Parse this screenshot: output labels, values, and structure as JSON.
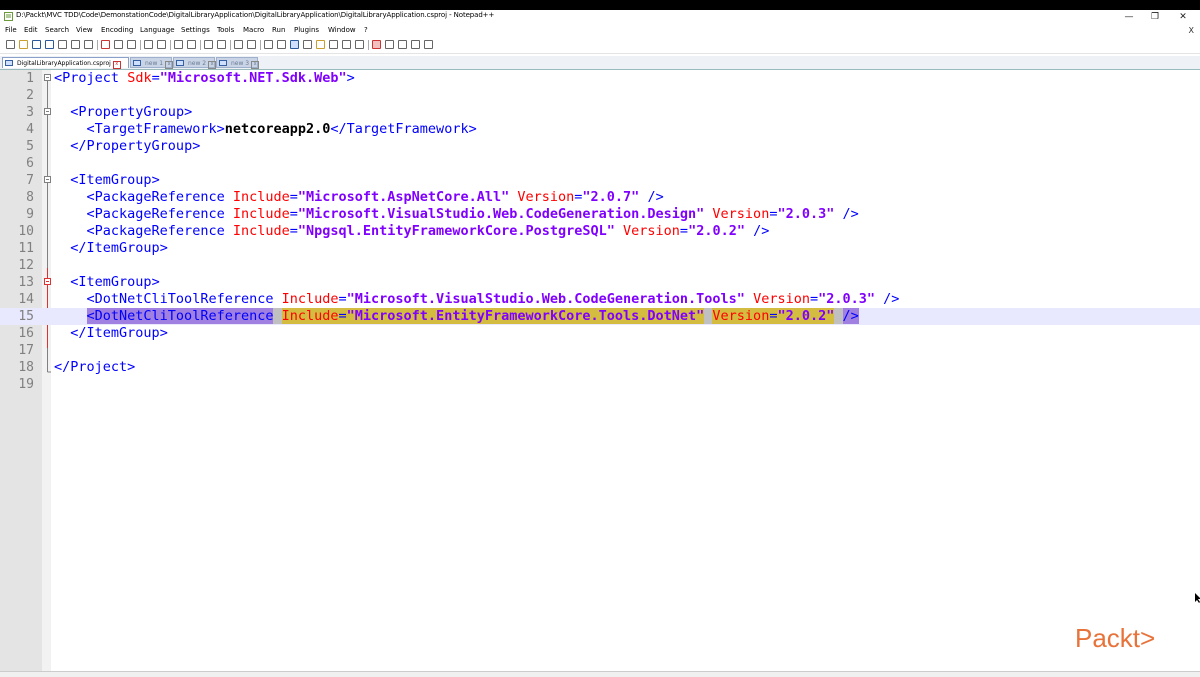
{
  "window": {
    "title": "D:\\Packt\\MVC TDD\\Code\\DemonstationCode\\DigitalLibraryApplication\\DigitalLibraryApplication\\DigitalLibraryApplication.csproj - Notepad++",
    "minimize": "—",
    "restore": "❐",
    "close": "✕",
    "doc_close": "X"
  },
  "menu": [
    "File",
    "Edit",
    "Search",
    "View",
    "Encoding",
    "Language",
    "Settings",
    "Tools",
    "Macro",
    "Run",
    "Plugins",
    "Window",
    "?"
  ],
  "tabs": [
    {
      "label": "DigitalLibraryApplication.csproj",
      "active": true
    },
    {
      "label": "new 1",
      "active": false
    },
    {
      "label": "new 2",
      "active": false
    },
    {
      "label": "new 3",
      "active": false
    }
  ],
  "editor": {
    "current_line": 15,
    "lines": [
      {
        "n": "1"
      },
      {
        "n": "2"
      },
      {
        "n": "3"
      },
      {
        "n": "4"
      },
      {
        "n": "5"
      },
      {
        "n": "6"
      },
      {
        "n": "7"
      },
      {
        "n": "8"
      },
      {
        "n": "9"
      },
      {
        "n": "10"
      },
      {
        "n": "11"
      },
      {
        "n": "12"
      },
      {
        "n": "13"
      },
      {
        "n": "14"
      },
      {
        "n": "15"
      },
      {
        "n": "16"
      },
      {
        "n": "17"
      },
      {
        "n": "18"
      },
      {
        "n": "19"
      }
    ],
    "code": {
      "project_open": "Project",
      "sdk_attr": "Sdk",
      "sdk_val": "\"Microsoft.NET.Sdk.Web\"",
      "propertygroup": "PropertyGroup",
      "targetframework": "TargetFramework",
      "targetframework_val": "netcoreapp2.0",
      "itemgroup": "ItemGroup",
      "packagereference": "PackageReference",
      "include": "Include",
      "version": "Version",
      "pkg1": "\"Microsoft.AspNetCore.All\"",
      "pkg1_ver": "\"2.0.7\"",
      "pkg2": "\"Microsoft.VisualStudio.Web.CodeGeneration.Design\"",
      "pkg2_ver": "\"2.0.3\"",
      "pkg3": "\"Npgsql.EntityFrameworkCore.PostgreSQL\"",
      "pkg3_ver": "\"2.0.2\"",
      "clitool": "DotNetCliToolReference",
      "tool1": "\"Microsoft.VisualStudio.Web.CodeGeneration.Tools\"",
      "tool1_ver": "\"2.0.3\"",
      "tool2": "\"Microsoft.EntityFrameworkCore.Tools.DotNet\"",
      "tool2_ver": "\"2.0.2\""
    }
  },
  "logo": {
    "text": "Packt>",
    "color": "#e8733a"
  }
}
